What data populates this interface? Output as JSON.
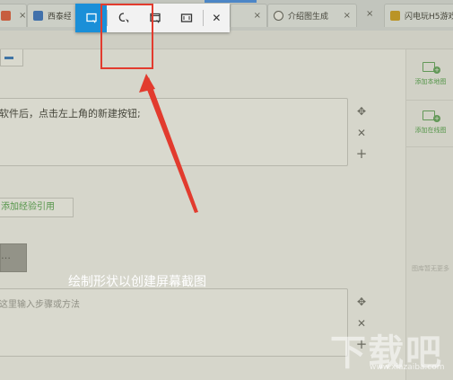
{
  "browser": {
    "tabs": [
      {
        "label": "",
        "close": "×",
        "color": "#e6553a"
      },
      {
        "label": "西泰经验",
        "close": "",
        "color": "#2d6fcf"
      },
      {
        "label": "",
        "close": "×",
        "color": "#9a9a9a"
      },
      {
        "label": "",
        "close": "",
        "color": "#9a9a9a"
      },
      {
        "label": "",
        "close": "×",
        "color": "#9a9a9a"
      },
      {
        "label": "介绍图生成",
        "close": "×",
        "color": "#666666"
      },
      {
        "label": "闪电玩H5游戏",
        "close": "",
        "color": "#d4a017"
      }
    ]
  },
  "snip_toolbar": {
    "buttons": [
      {
        "name": "rectangle-snip",
        "active": true
      },
      {
        "name": "freeform-snip",
        "active": false
      },
      {
        "name": "window-snip",
        "active": false
      },
      {
        "name": "fullscreen-snip",
        "active": false
      }
    ],
    "close_label": "✕"
  },
  "editor": {
    "step1_text": "软件后，点击左上角的新建按钮;",
    "step2_placeholder": "这里输入步骤或方法",
    "controls": {
      "move": "✥",
      "remove": "✕",
      "add": "+"
    },
    "add_reference_label": "添加经验引用",
    "more_label": "…"
  },
  "right_panel": {
    "add_local_image": "添加本地图",
    "add_online_image": "添加在线图",
    "hint": "图库暂无更多"
  },
  "annotation": {
    "caption": "绘制形状以创建屏幕截图",
    "highlight_color": "#e23b2e"
  },
  "watermark": {
    "text": "下载吧",
    "sub": "www.xiazaiba.com"
  }
}
